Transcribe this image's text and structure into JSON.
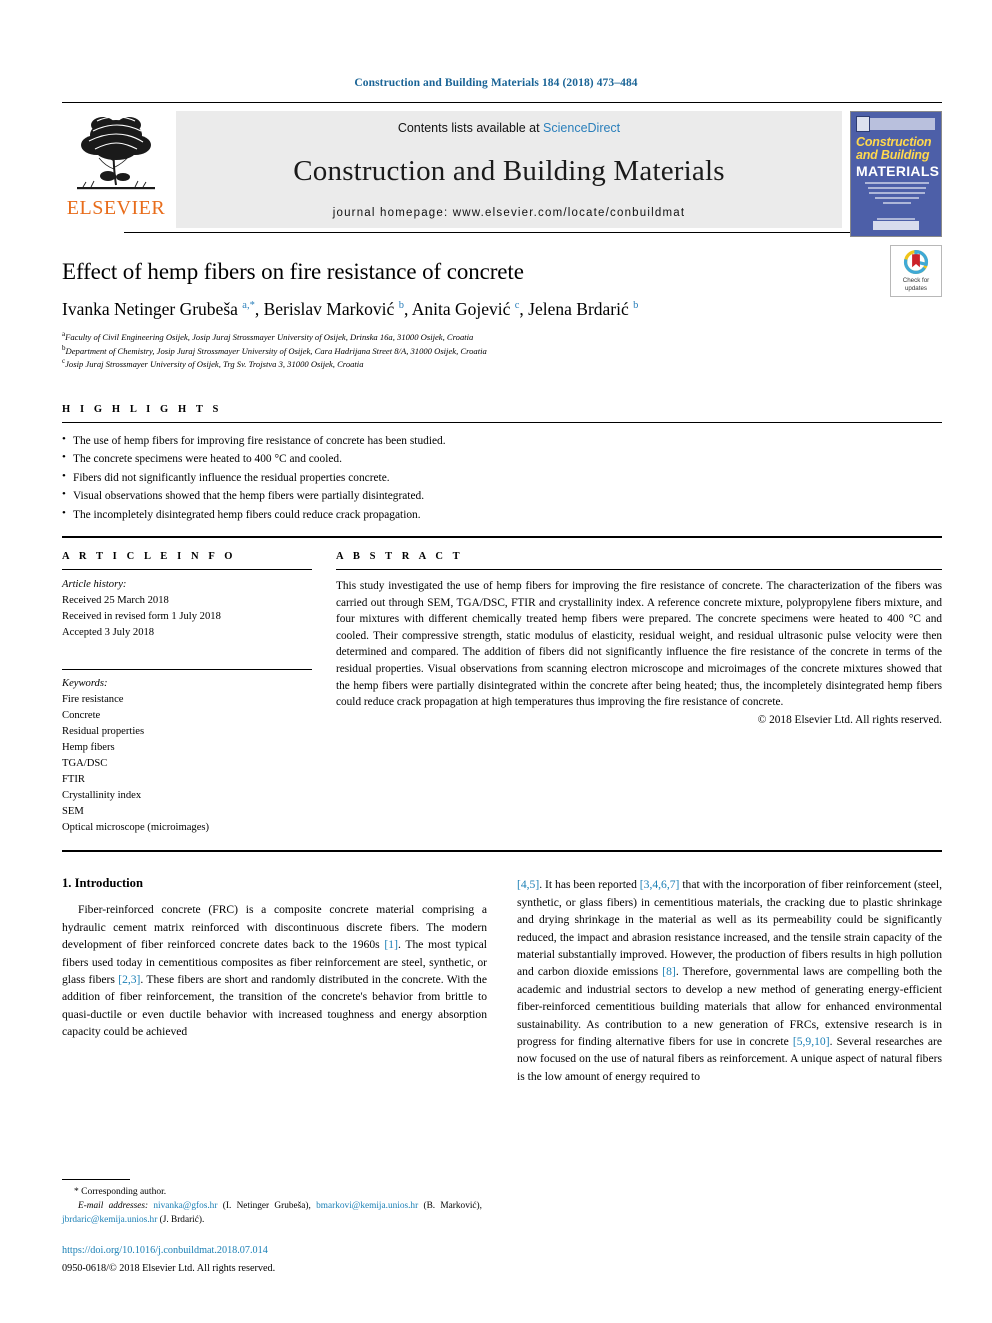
{
  "running_head": "Construction and Building Materials 184 (2018) 473–484",
  "masthead": {
    "publisher_logo_text": "ELSEVIER",
    "contents_prefix": "Contents lists available at ",
    "contents_link": "ScienceDirect",
    "journal_name": "Construction and Building Materials",
    "homepage_line": "journal homepage: www.elsevier.com/locate/conbuildmat",
    "cover": {
      "line1": "Construction",
      "line2": "and Building",
      "line3": "MATERIALS"
    }
  },
  "article": {
    "title": "Effect of hemp fibers on fire resistance of concrete",
    "authors_html": "Ivanka Netinger Grubeša <sup>a,*</sup>, Berislav Marković <sup>b</sup>, Anita Gojević <sup>c</sup>, Jelena Brdarić <sup>b</sup>",
    "affiliations": [
      {
        "marker": "a",
        "text": "Faculty of Civil Engineering Osijek, Josip Juraj Strossmayer University of Osijek, Drinska 16a, 31000 Osijek, Croatia"
      },
      {
        "marker": "b",
        "text": "Department of Chemistry, Josip Juraj Strossmayer University of Osijek, Cara Hadrijana Street 8/A, 31000 Osijek, Croatia"
      },
      {
        "marker": "c",
        "text": "Josip Juraj Strossmayer University of Osijek, Trg Sv. Trojstva 3, 31000 Osijek, Croatia"
      }
    ],
    "crossmark_label": "Check for\nupdates"
  },
  "highlights": {
    "heading": "H I G H L I G H T S",
    "items": [
      "The use of hemp fibers for improving fire resistance of concrete has been studied.",
      "The concrete specimens were heated to 400 °C and cooled.",
      "Fibers did not significantly influence the residual properties concrete.",
      "Visual observations showed that the hemp fibers were partially disintegrated.",
      "The incompletely disintegrated hemp fibers could reduce crack propagation."
    ]
  },
  "article_info": {
    "heading": "A R T I C L E   I N F O",
    "history_label": "Article history:",
    "history": [
      "Received 25 March 2018",
      "Received in revised form 1 July 2018",
      "Accepted 3 July 2018"
    ],
    "keywords_label": "Keywords:",
    "keywords": [
      "Fire resistance",
      "Concrete",
      "Residual properties",
      "Hemp fibers",
      "TGA/DSC",
      "FTIR",
      "Crystallinity index",
      "SEM",
      "Optical microscope (microimages)"
    ]
  },
  "abstract": {
    "heading": "A B S T R A C T",
    "text": "This study investigated the use of hemp fibers for improving the fire resistance of concrete. The characterization of the fibers was carried out through SEM, TGA/DSC, FTIR and crystallinity index. A reference concrete mixture, polypropylene fibers mixture, and four mixtures with different chemically treated hemp fibers were prepared. The concrete specimens were heated to 400 °C and cooled. Their compressive strength, static modulus of elasticity, residual weight, and residual ultrasonic pulse velocity were then determined and compared. The addition of fibers did not significantly influence the fire resistance of the concrete in terms of the residual properties. Visual observations from scanning electron microscope and microimages of the concrete mixtures showed that the hemp fibers were partially disintegrated within the concrete after being heated; thus, the incompletely disintegrated hemp fibers could reduce crack propagation at high temperatures thus improving the fire resistance of concrete.",
    "copyright": "© 2018 Elsevier Ltd. All rights reserved."
  },
  "body": {
    "section_title": "1. Introduction",
    "left_paragraph_html": "Fiber-reinforced concrete (FRC) is a composite concrete material comprising a hydraulic cement matrix reinforced with discontinuous discrete fibers. The modern development of fiber reinforced concrete dates back to the 1960s <span class=\"ref\">[1]</span>. The most typical fibers used today in cementitious composites as fiber reinforcement are steel, synthetic, or glass fibers <span class=\"ref\">[2,3]</span>. These fibers are short and randomly distributed in the concrete. With the addition of fiber reinforcement, the transition of the concrete's behavior from brittle to quasi-ductile or even ductile behavior with increased toughness and energy absorption capacity could be achieved",
    "right_paragraph_html": "<span class=\"ref\">[4,5]</span>. It has been reported <span class=\"ref\">[3,4,6,7]</span> that with the incorporation of fiber reinforcement (steel, synthetic, or glass fibers) in cementitious materials, the cracking due to plastic shrinkage and drying shrinkage in the material as well as its permeability could be significantly reduced, the impact and abrasion resistance increased, and the tensile strain capacity of the material substantially improved. However, the production of fibers results in high pollution and carbon dioxide emissions <span class=\"ref\">[8]</span>. Therefore, governmental laws are compelling both the academic and industrial sectors to develop a new method of generating energy-efficient fiber-reinforced cementitious building materials that allow for enhanced environmental sustainability. As contribution to a new generation of FRCs, extensive research is in progress for finding alternative fibers for use in concrete <span class=\"ref\">[5,9,10]</span>. Several researches are now focused on the use of natural fibers as reinforcement. A unique aspect of natural fibers is the low amount of energy required to"
  },
  "footnotes": {
    "corresponding": "* Corresponding author.",
    "email_label": "E-mail addresses:",
    "email_html": " <span class=\"mail\">nivanka@gfos.hr</span> (I. Netinger Grubeša), <span class=\"mail\">bmarkovi@kemija.unios.hr</span> (B. Marković), <span class=\"mail\">jbrdaric@kemija.unios.hr</span> (J. Brdarić)."
  },
  "doi": {
    "url": "https://doi.org/10.1016/j.conbuildmat.2018.07.014",
    "issn_line": "0950-0618/© 2018 Elsevier Ltd. All rights reserved."
  },
  "colors": {
    "link_blue": "#1a7fb5",
    "elsevier_orange": "#e86c1a",
    "cover_blue": "#4d5fa8",
    "masthead_grey": "#ebebeb"
  }
}
